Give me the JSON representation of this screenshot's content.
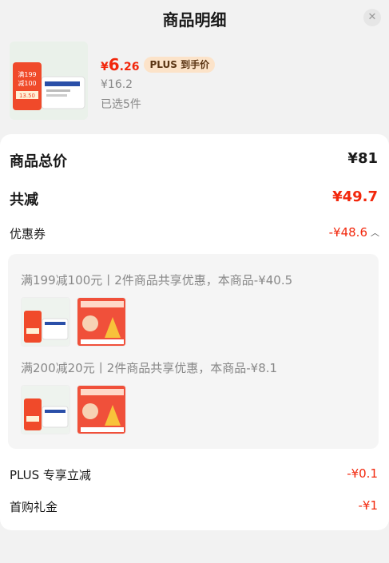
{
  "header": {
    "title": "商品明细",
    "close_icon": "close-icon"
  },
  "product": {
    "price_symbol": "¥",
    "price_integer": "6",
    "price_decimal": ".26",
    "plus_tag": "PLUS 到手价",
    "original_price": "¥16.2",
    "selected_count": "已选5件",
    "thumb_badge_line1": "满199",
    "thumb_badge_line2": "减100",
    "thumb_badge_price": "13.50"
  },
  "details": {
    "total_label": "商品总价",
    "total_value": "¥81",
    "discount_label": "共减",
    "discount_value": "¥49.7",
    "coupon_label": "优惠券",
    "coupon_value": "-¥48.6",
    "coupons": [
      {
        "text": "满199减100元丨2件商品共享优惠，本商品-¥40.5"
      },
      {
        "text": "满200减20元丨2件商品共享优惠，本商品-¥8.1"
      }
    ],
    "plus_label": "PLUS 专享立减",
    "plus_value": "-¥0.1",
    "first_label": "首购礼金",
    "first_value": "-¥1"
  },
  "colors": {
    "accent": "#f2270c",
    "plus_tag_bg": "#fce3c9",
    "muted_text": "#888888"
  }
}
